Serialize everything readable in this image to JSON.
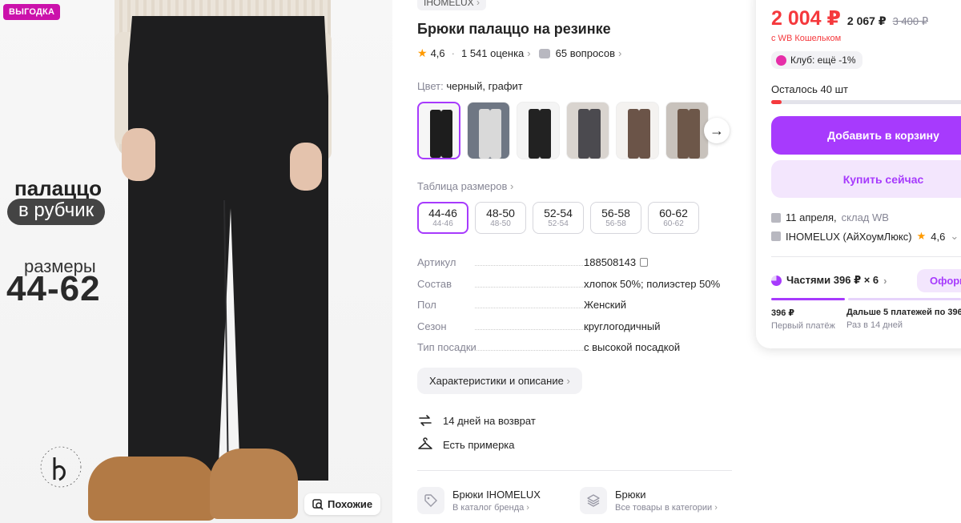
{
  "product_image": {
    "sale_badge": "ВЫГОДКА",
    "promo_title": "палаццо",
    "promo_subtitle": "в рубчик",
    "promo_sizes_label": "размеры",
    "promo_sizes_value": "44-62",
    "similar_button": "Похожие"
  },
  "brand": {
    "name": "IHOMELUX",
    "chevron": "›"
  },
  "title": "Брюки палаццо на резинке",
  "rating": {
    "value": "4,6",
    "reviews": "1 541 оценка",
    "questions": "65 вопросов"
  },
  "color": {
    "label": "Цвет:",
    "value": "черный, графит"
  },
  "swatches": [
    {
      "name": "black",
      "bg": "#f6f6f6",
      "pants": "#1d1d1d",
      "active": true
    },
    {
      "name": "grey",
      "bg": "#6f7784",
      "pants": "#d9d9d9",
      "active": false
    },
    {
      "name": "black-2",
      "bg": "#f4f4f4",
      "pants": "#222222",
      "active": false
    },
    {
      "name": "graphite",
      "bg": "#d9d4cf",
      "pants": "#4b4a4f",
      "active": false
    },
    {
      "name": "brown",
      "bg": "#f4f2f0",
      "pants": "#6b5448",
      "active": false
    },
    {
      "name": "brown-2",
      "bg": "#c8c2bc",
      "pants": "#6d5749",
      "active": false
    }
  ],
  "size_table_link": "Таблица размеров",
  "sizes": [
    {
      "label": "44-46",
      "sub": "44-46",
      "active": true
    },
    {
      "label": "48-50",
      "sub": "48-50",
      "active": false
    },
    {
      "label": "52-54",
      "sub": "52-54",
      "active": false
    },
    {
      "label": "56-58",
      "sub": "56-58",
      "active": false
    },
    {
      "label": "60-62",
      "sub": "60-62",
      "active": false
    }
  ],
  "specs": [
    {
      "key": "Артикул",
      "value": "188508143"
    },
    {
      "key": "Состав",
      "value": "хлопок 50%; полиэстер 50%"
    },
    {
      "key": "Пол",
      "value": "Женский"
    },
    {
      "key": "Сезон",
      "value": "круглогодичный"
    },
    {
      "key": "Тип посадки",
      "value": "с высокой посадкой"
    }
  ],
  "characteristics_button": "Характеристики и описание",
  "perks": {
    "returns": "14 дней на возврат",
    "fitting": "Есть примерка"
  },
  "category_links": {
    "brand": {
      "title": "Брюки IHOMELUX",
      "subtitle": "В каталог бренда"
    },
    "category": {
      "title": "Брюки",
      "subtitle": "Все товары в категории"
    }
  },
  "buy": {
    "price": "2 004 ₽",
    "price_no_wallet": "2 067 ₽",
    "price_old": "3 400 ₽",
    "wallet_note": "с WB Кошельком",
    "club": "Клуб: ещё -1%",
    "stock_text": "Осталось 40 шт",
    "stock_fraction": 0.05,
    "add_to_cart": "Добавить в корзину",
    "buy_now": "Купить сейчас",
    "delivery_date": "11 апреля,",
    "delivery_warehouse": "склад WB",
    "seller": "IHOMELUX (АйХоумЛюкс)",
    "seller_rating": "4,6",
    "installments": "Частями 396 ₽ × 6",
    "installments_button": "Оформ",
    "first_payment_value": "396 ₽",
    "first_payment_label": "Первый платёж",
    "next_payments_value": "Дальше 5 платежей по 396",
    "next_payments_label": "Раз в 14 дней"
  },
  "colors": {
    "accent": "#a73afd",
    "price_red": "#f5393d",
    "sale_badge": "#cb11ab"
  }
}
